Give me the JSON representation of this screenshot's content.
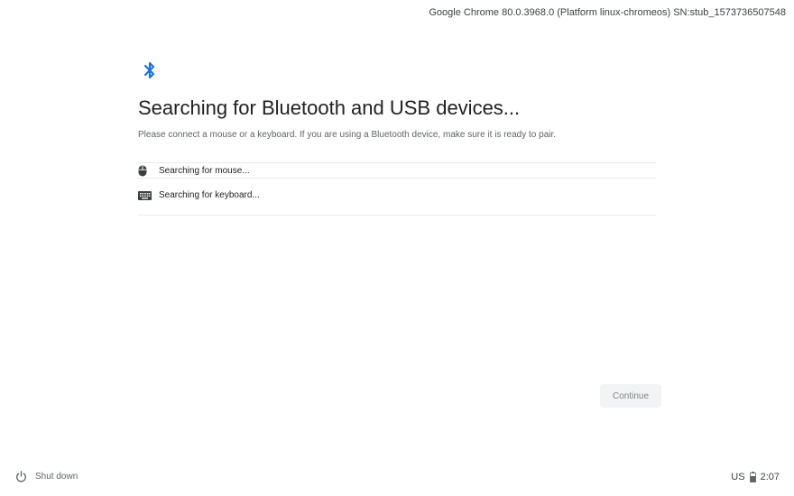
{
  "header": {
    "version_info": "Google Chrome 80.0.3968.0 (Platform linux-chromeos) SN:stub_1573736507548"
  },
  "main": {
    "icon": "bluetooth-icon",
    "title": "Searching for Bluetooth and USB devices...",
    "subtitle": "Please connect a mouse or a keyboard. If you are using a Bluetooth device, make sure it is ready to pair.",
    "devices": [
      {
        "icon": "mouse-icon",
        "label": "Searching for mouse..."
      },
      {
        "icon": "keyboard-icon",
        "label": "Searching for keyboard..."
      }
    ],
    "continue_label": "Continue"
  },
  "shelf": {
    "shutdown_icon": "power-icon",
    "shutdown_label": "Shut down",
    "ime": "US",
    "battery_icon": "battery-icon",
    "time": "2:07"
  },
  "colors": {
    "accent": "#1a73e8",
    "button_bg": "#f1f3f4",
    "button_text": "#80868b"
  }
}
